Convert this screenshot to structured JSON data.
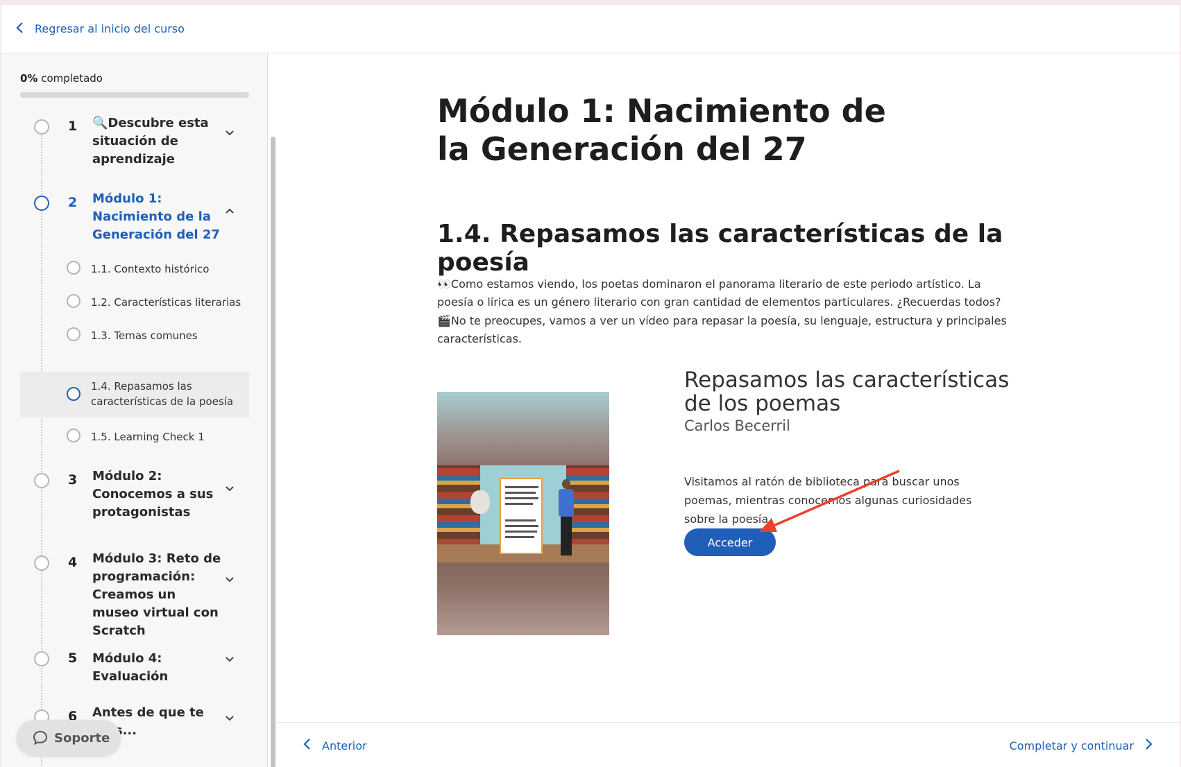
{
  "topbar": {
    "back_label": "Regresar al inicio del curso"
  },
  "sidebar": {
    "progress_percent": "0%",
    "progress_label": "completado",
    "progress_value": 0,
    "modules": [
      {
        "number": "1",
        "title": "🔍Descubre esta situación de aprendizaje",
        "state": "collapsed"
      },
      {
        "number": "2",
        "title": "Módulo 1: Nacimiento de la Generación del 27",
        "state": "expanded"
      },
      {
        "number": "3",
        "title": "Módulo 2: Conocemos a sus protagonistas",
        "state": "collapsed"
      },
      {
        "number": "4",
        "title": "Módulo 3: Reto de programación: Creamos un museo virtual con Scratch",
        "state": "collapsed"
      },
      {
        "number": "5",
        "title": "Módulo 4: Evaluación",
        "state": "collapsed"
      },
      {
        "number": "6",
        "title": "Antes de que te ...os...",
        "state": "collapsed"
      }
    ],
    "lessons": [
      {
        "title": "1.1. Contexto histórico"
      },
      {
        "title": "1.2. Características literarias"
      },
      {
        "title": "1.3. Temas comunes"
      },
      {
        "title": "1.4. Repasamos las características de la poesía",
        "current": true
      },
      {
        "title": "1.5. Learning Check 1"
      }
    ],
    "support_label": "Soporte"
  },
  "main": {
    "module_heading": "Módulo 1: Nacimiento de la Generación del 27",
    "lesson_heading": "1.4. Repasamos las características de la poesía",
    "paragraph_1": "👀Como estamos viendo, los poetas dominaron el panorama literario de este periodo artístico. La poesía o lírica es un género literario con gran cantidad de elementos particulares. ¿Recuerdas todos?",
    "paragraph_2": "🎬No te preocupes, vamos a ver un vídeo para repasar la poesía, su lenguaje, estructura y principales características.",
    "video": {
      "title": "Repasamos las características de los poemas",
      "author": "Carlos Becerril",
      "description": "Visitamos al ratón de biblioteca para buscar unos poemas, mientras conocemos algunas curiosidades sobre la poesía.",
      "button_label": "Acceder"
    }
  },
  "bottom_nav": {
    "prev_label": "Anterior",
    "next_label": "Completar y continuar"
  },
  "colors": {
    "accent": "#1f5fb8",
    "annotation_arrow": "#e8412c",
    "sidebar_bg": "#f7f7f7"
  }
}
